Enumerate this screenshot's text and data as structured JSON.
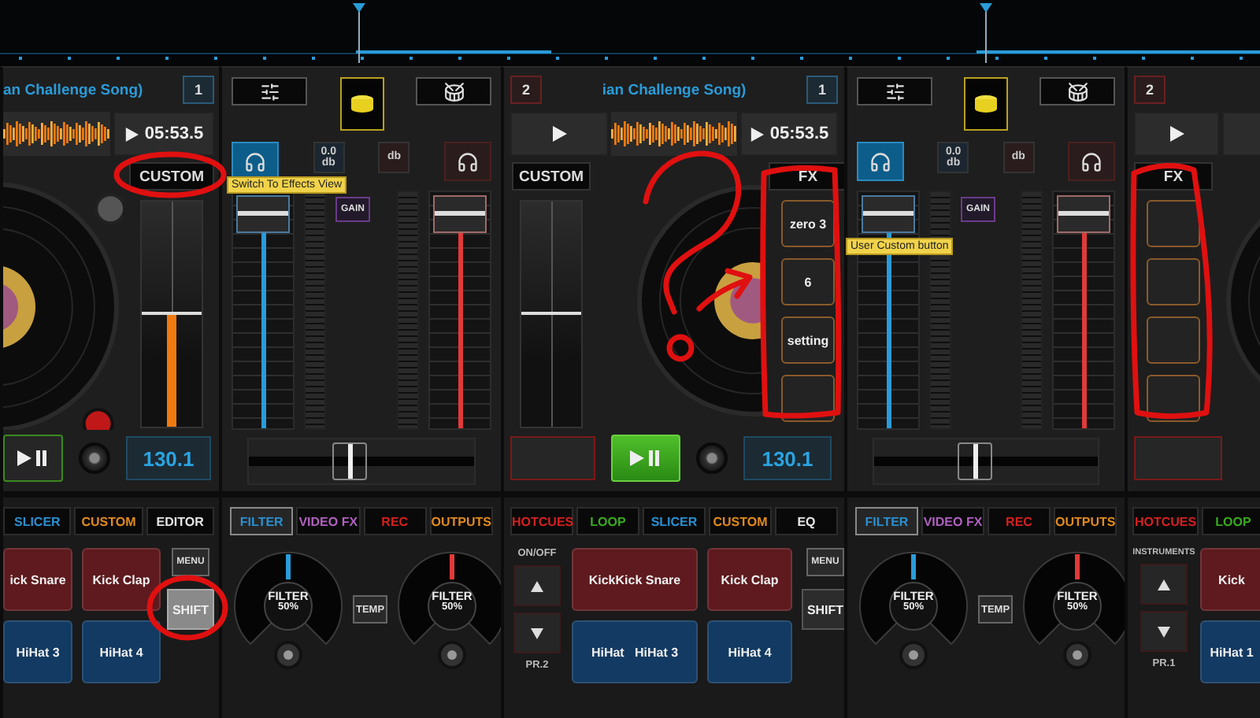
{
  "deck_left": {
    "title": "an Challenge Song)",
    "deck_number": "1",
    "time": "05:53.5",
    "custom_button": "CUSTOM",
    "tooltip": "Switch To Effects View",
    "pitch": {
      "level": 0.5
    },
    "playing": false,
    "bpm": "130.1",
    "tabs": [
      {
        "label": "SLICER",
        "color": "#2a8fd0",
        "selected": false
      },
      {
        "label": "CUSTOM",
        "color": "#e08a20",
        "selected": false
      },
      {
        "label": "EDITOR",
        "color": "#e6e6e6",
        "selected": false
      }
    ],
    "pads": [
      {
        "label": "ick Snare",
        "color": "#5e1a1e"
      },
      {
        "label": "Kick Clap",
        "color": "#5e1a1e"
      },
      {
        "label": "HiHat 3",
        "color": "#123a62"
      },
      {
        "label": "HiHat 4",
        "color": "#123a62"
      }
    ],
    "menu_button": "MENU",
    "shift_button": {
      "label": "SHIFT",
      "pressed": true
    }
  },
  "mixers": [
    {
      "gain_readouts": [
        {
          "value": "0.0",
          "unit": "db"
        },
        {
          "unit": "db"
        }
      ],
      "gain_button": "GAIN",
      "faders": [
        {
          "level": 0.95
        },
        {
          "level": 0.95
        }
      ],
      "crossfader": {
        "level": 0.45
      },
      "tabs": [
        {
          "label": "FILTER",
          "color": "#2a8fd0",
          "selected": true
        },
        {
          "label": "VIDEO FX",
          "color": "#b060c0",
          "selected": false
        },
        {
          "label": "REC",
          "color": "#d42020",
          "selected": false
        },
        {
          "label": "OUTPUTS",
          "color": "#e08a20",
          "selected": false
        }
      ],
      "temp_button": "TEMP",
      "filters": [
        {
          "label": "FILTER",
          "value": "50%"
        },
        {
          "label": "FILTER",
          "value": "50%"
        }
      ]
    },
    {
      "gain_readouts": [
        {
          "value": "0.0",
          "unit": "db"
        },
        {
          "unit": "db"
        }
      ],
      "gain_button": "GAIN",
      "faders": [
        {
          "level": 0.95
        },
        {
          "level": 0.95
        }
      ],
      "crossfader": {
        "level": 0.45
      },
      "tabs": [
        {
          "label": "FILTER",
          "color": "#2a8fd0",
          "selected": true
        },
        {
          "label": "VIDEO FX",
          "color": "#b060c0",
          "selected": false
        },
        {
          "label": "REC",
          "color": "#d42020",
          "selected": false
        },
        {
          "label": "OUTPUTS",
          "color": "#e08a20",
          "selected": false
        }
      ],
      "temp_button": "TEMP",
      "filters": [
        {
          "label": "FILTER",
          "value": "50%"
        },
        {
          "label": "FILTER",
          "value": "50%"
        }
      ]
    }
  ],
  "deck_center": {
    "deck_number": "2",
    "title": "ian Challenge Song)",
    "linked_deck_number": "1",
    "time": "05:53.5",
    "custom_button": "CUSTOM",
    "fx_button": "FX",
    "pitch": {
      "level": 0.5
    },
    "fx_pads": [
      {
        "kind": "labeled",
        "label": "zero 3"
      },
      {
        "kind": "labeled",
        "label": "6"
      },
      {
        "kind": "labeled",
        "label": "setting"
      },
      {
        "kind": "empty"
      }
    ],
    "tooltip": "User Custom button",
    "playing": true,
    "bpm": "130.1",
    "tabs": [
      {
        "label": "HOTCUES",
        "color": "#d42020",
        "selected": false
      },
      {
        "label": "LOOP",
        "color": "#3aa820",
        "selected": false
      },
      {
        "label": "SLICER",
        "color": "#2a8fd0",
        "selected": false
      },
      {
        "label": "CUSTOM",
        "color": "#e08a20",
        "selected": false
      },
      {
        "label": "EQ",
        "color": "#e6e6e6",
        "selected": false
      }
    ],
    "bank_label": "ON/OFF",
    "preset": "PR.2",
    "pads": [
      {
        "label": "KickKick Snare",
        "color": "#5e1a1e"
      },
      {
        "label": "Kick Clap",
        "color": "#5e1a1e"
      },
      {
        "label": "HiHat   HiHat 3",
        "color": "#123a62"
      },
      {
        "label": "HiHat 4",
        "color": "#123a62"
      }
    ],
    "menu_button": "MENU",
    "shift_button": {
      "label": "SHIFT",
      "pressed": false
    }
  },
  "deck_right": {
    "deck_number": "2",
    "fx_button": "FX",
    "fx_pads": [
      {
        "kind": "empty"
      },
      {
        "kind": "empty"
      },
      {
        "kind": "empty"
      },
      {
        "kind": "empty"
      }
    ],
    "tabs": [
      {
        "label": "HOTCUES",
        "color": "#d42020",
        "selected": false
      },
      {
        "label": "LOOP",
        "color": "#3aa820",
        "selected": false
      }
    ],
    "bank_label": "INSTRUMENTS",
    "preset": "PR.1",
    "pads": [
      {
        "label": "Kick",
        "color": "#5e1a1e"
      },
      {
        "label": "HiHat 1",
        "color": "#123a62"
      }
    ]
  }
}
